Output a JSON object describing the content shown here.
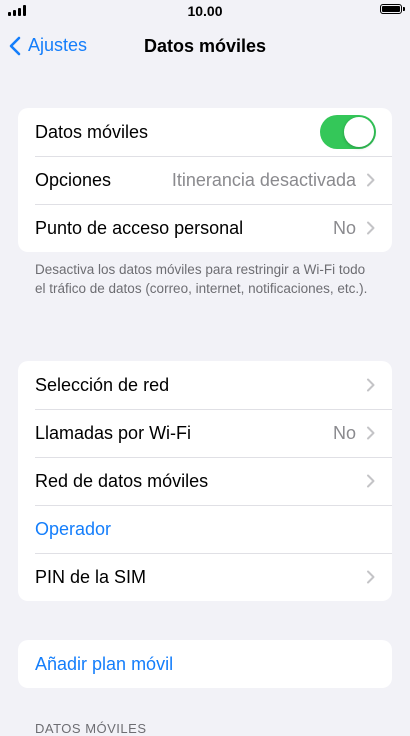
{
  "status_bar": {
    "time": "10.00"
  },
  "nav": {
    "back_label": "Ajustes",
    "title": "Datos móviles"
  },
  "group1": {
    "mobile_data": {
      "label": "Datos móviles",
      "toggle_on": true
    },
    "options": {
      "label": "Opciones",
      "value": "Itinerancia desactivada"
    },
    "hotspot": {
      "label": "Punto de acceso personal",
      "value": "No"
    }
  },
  "footnote": "Desactiva los datos móviles para restringir a Wi-Fi todo el tráfico de datos (correo, internet, notificaciones, etc.).",
  "group2": {
    "network_selection": {
      "label": "Selección de red"
    },
    "wifi_calling": {
      "label": "Llamadas por Wi-Fi",
      "value": "No"
    },
    "mobile_data_network": {
      "label": "Red de datos móviles"
    },
    "carrier": {
      "label": "Operador"
    },
    "sim_pin": {
      "label": "PIN de la SIM"
    }
  },
  "group3": {
    "add_plan": {
      "label": "Añadir plan móvil"
    }
  },
  "section_header": "DATOS MÓVILES",
  "colors": {
    "accent": "#147efb",
    "toggle_on": "#34c759",
    "background": "#f2f2f7"
  }
}
